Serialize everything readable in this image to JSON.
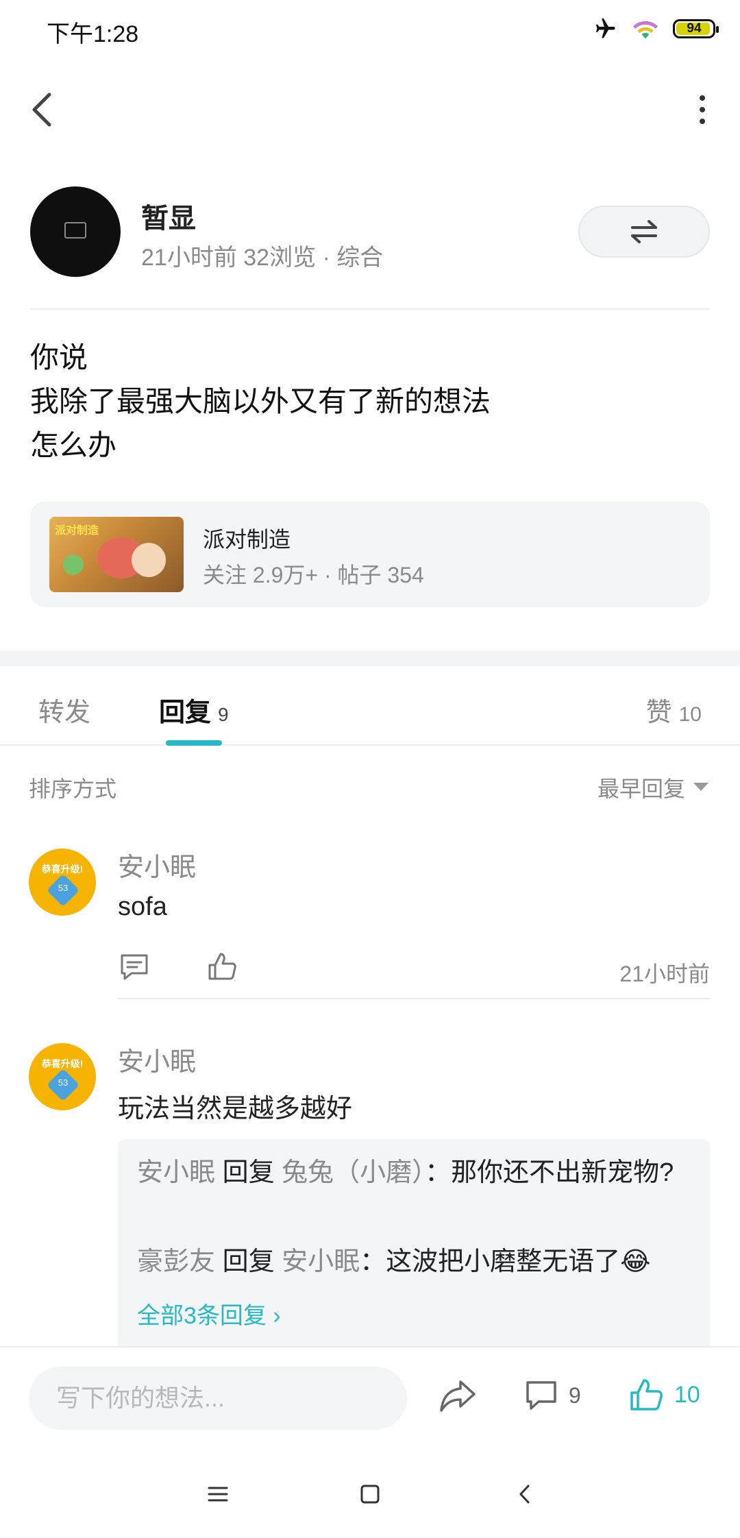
{
  "status_bar": {
    "time": "下午1:28",
    "battery": "94",
    "icons": [
      "airplane-icon",
      "wifi-icon",
      "battery-icon"
    ]
  },
  "nav": {
    "icons": [
      "back-arrow-icon",
      "more-vertical-icon"
    ]
  },
  "author": {
    "name": "暂显",
    "meta": "21小时前  32浏览 · 综合",
    "switch_icon": "swap-arrows-icon"
  },
  "post": {
    "lines": [
      "你说",
      "我除了最强大脑以外又有了新的想法",
      "怎么办"
    ]
  },
  "topic": {
    "thumb_text": "派对制造",
    "name": "派对制造",
    "meta": "关注 2.9万+  ·  帖子 354"
  },
  "tabs": {
    "repost": "转发",
    "reply": "回复",
    "reply_count": "9",
    "like": "赞",
    "like_count": "10"
  },
  "sort": {
    "label": "排序方式",
    "value": "最早回复"
  },
  "comments": [
    {
      "avatar_text": "恭喜升级!",
      "level": "53",
      "name": "安小眠",
      "text": "sofa",
      "time": "21小时前"
    },
    {
      "avatar_text": "恭喜升级!",
      "level": "53",
      "name": "安小眠",
      "text": "玩法当然是越多越好",
      "replies": [
        {
          "from": "安小眠",
          "verb": "回复",
          "to": "兔兔（小磨）",
          "content": "：那你还不出新宠物?"
        },
        {
          "from": "豪彭友",
          "verb": "回复",
          "to": "安小眠",
          "content": "：这波把小磨整无语了😂"
        }
      ],
      "all_replies": "全部3条回复 ›"
    }
  ],
  "bottom_bar": {
    "placeholder": "写下你的想法...",
    "comment_count": "9",
    "like_count": "10"
  },
  "colors": {
    "accent": "#25b9c5",
    "muted": "#8a8a8a",
    "card_bg": "#f4f5f7"
  }
}
